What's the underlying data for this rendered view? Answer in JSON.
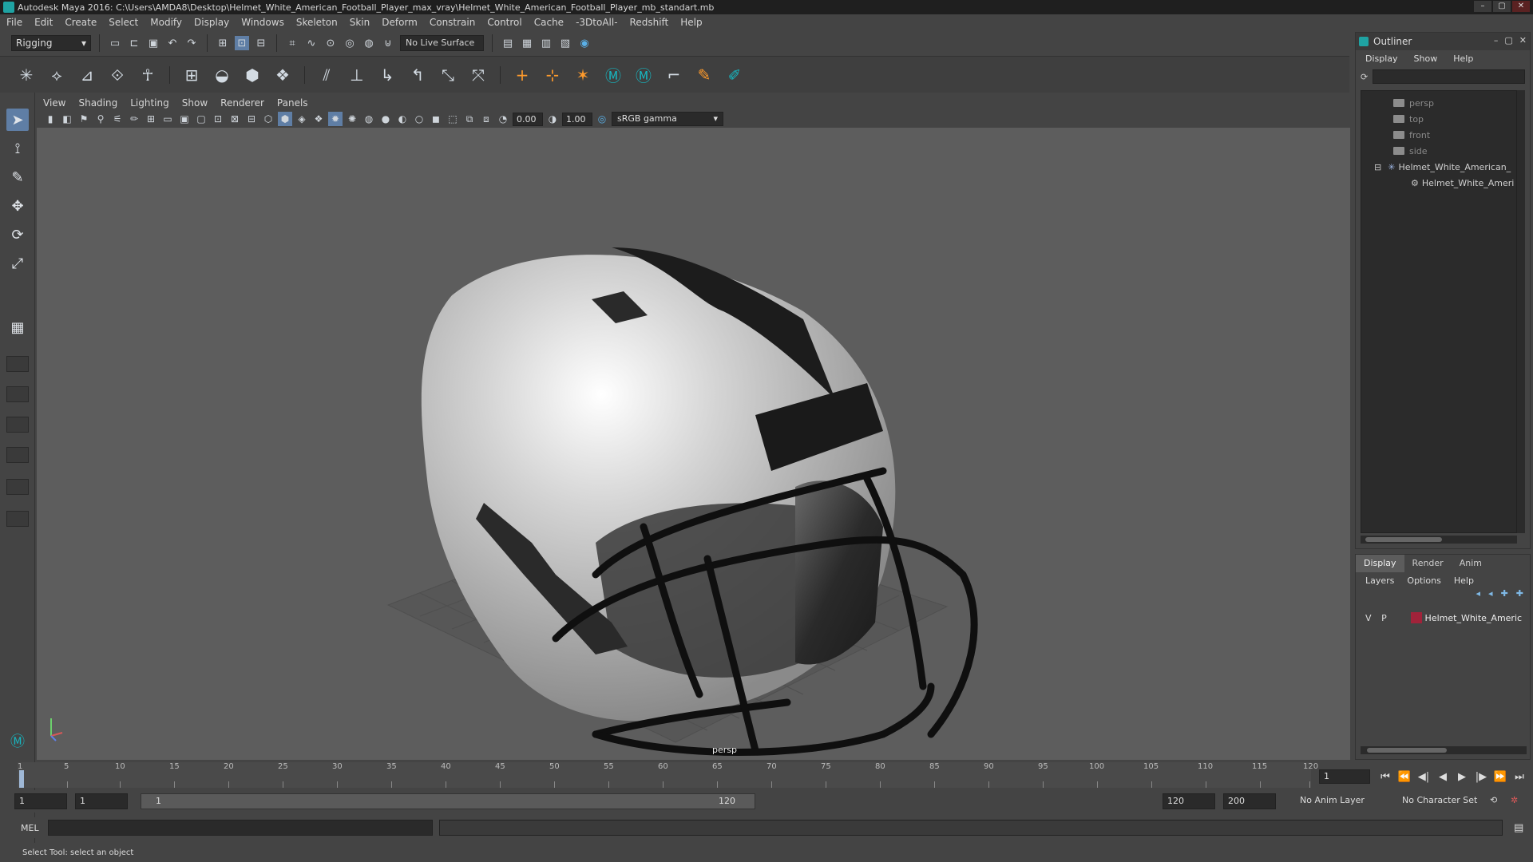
{
  "window": {
    "title": "Autodesk Maya 2016: C:\\Users\\AMDA8\\Desktop\\Helmet_White_American_Football_Player_max_vray\\Helmet_White_American_Football_Player_mb_standart.mb"
  },
  "menubar": [
    "File",
    "Edit",
    "Create",
    "Select",
    "Modify",
    "Display",
    "Windows",
    "Skeleton",
    "Skin",
    "Deform",
    "Constrain",
    "Control",
    "Cache",
    "-3DtoAll-",
    "Redshift",
    "Help"
  ],
  "shelf": {
    "mode": "Rigging",
    "live_surface": "No Live Surface"
  },
  "panel": {
    "menu": [
      "View",
      "Shading",
      "Lighting",
      "Show",
      "Renderer",
      "Panels"
    ],
    "exposure": "0.00",
    "gamma_value": "1.00",
    "color_space": "sRGB gamma",
    "camera": "persp"
  },
  "timeline": {
    "ticks": [
      "1",
      "5",
      "10",
      "15",
      "20",
      "25",
      "30",
      "35",
      "40",
      "45",
      "50",
      "55",
      "60",
      "65",
      "70",
      "75",
      "80",
      "85",
      "90",
      "95",
      "100",
      "105",
      "110",
      "115",
      "120"
    ],
    "current_frame": "1"
  },
  "range": {
    "start": "1",
    "playback_start": "1",
    "slider_start": "1",
    "slider_end": "120",
    "playback_end": "120",
    "end": "200",
    "anim_layer": "No Anim Layer",
    "char_set": "No Character Set"
  },
  "cmd": {
    "lang": "MEL"
  },
  "help": "Select Tool: select an object",
  "outliner": {
    "title": "Outliner",
    "menu": [
      "Display",
      "Show",
      "Help"
    ],
    "items": [
      {
        "label": "persp"
      },
      {
        "label": "top"
      },
      {
        "label": "front"
      },
      {
        "label": "side"
      },
      {
        "label": "Helmet_White_American_"
      },
      {
        "label": "Helmet_White_Ameri"
      }
    ]
  },
  "layers": {
    "tabs": [
      "Display",
      "Render",
      "Anim"
    ],
    "menu": [
      "Layers",
      "Options",
      "Help"
    ],
    "row": {
      "v": "V",
      "p": "P",
      "name": "Helmet_White_Americ",
      "color": "#a1233a"
    }
  }
}
